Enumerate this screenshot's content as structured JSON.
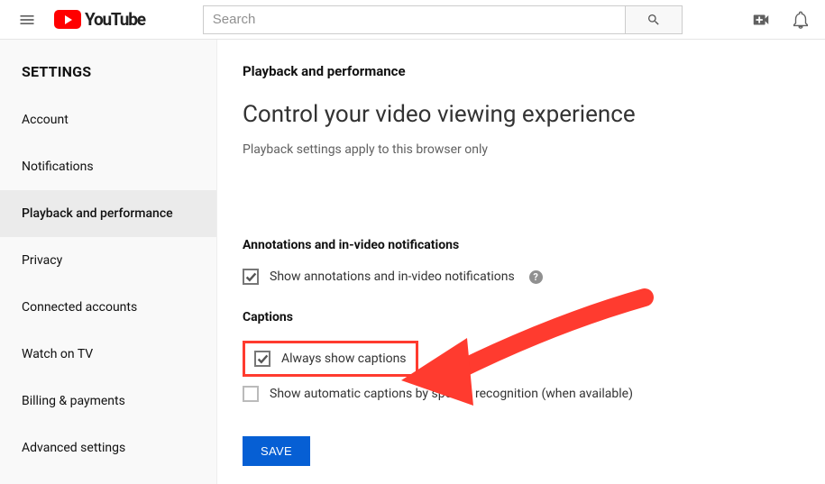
{
  "header": {
    "logo_text": "YouTube",
    "search_placeholder": "Search"
  },
  "sidebar": {
    "heading": "SETTINGS",
    "items": [
      {
        "label": "Account",
        "active": false
      },
      {
        "label": "Notifications",
        "active": false
      },
      {
        "label": "Playback and performance",
        "active": true
      },
      {
        "label": "Privacy",
        "active": false
      },
      {
        "label": "Connected accounts",
        "active": false
      },
      {
        "label": "Watch on TV",
        "active": false
      },
      {
        "label": "Billing & payments",
        "active": false
      },
      {
        "label": "Advanced settings",
        "active": false
      }
    ]
  },
  "main": {
    "section_title": "Playback and performance",
    "page_title": "Control your video viewing experience",
    "page_subtext": "Playback settings apply to this browser only",
    "annotations": {
      "title": "Annotations and in-video notifications",
      "opt1_label": "Show annotations and in-video notifications",
      "opt1_checked": true
    },
    "captions": {
      "title": "Captions",
      "opt1_label": "Always show captions",
      "opt1_checked": true,
      "opt2_label": "Show automatic captions by speech recognition (when available)",
      "opt2_checked": false
    },
    "save_label": "SAVE"
  },
  "annotation": {
    "highlight_target": "always-show-captions",
    "arrow_color": "#ff3b2f"
  }
}
